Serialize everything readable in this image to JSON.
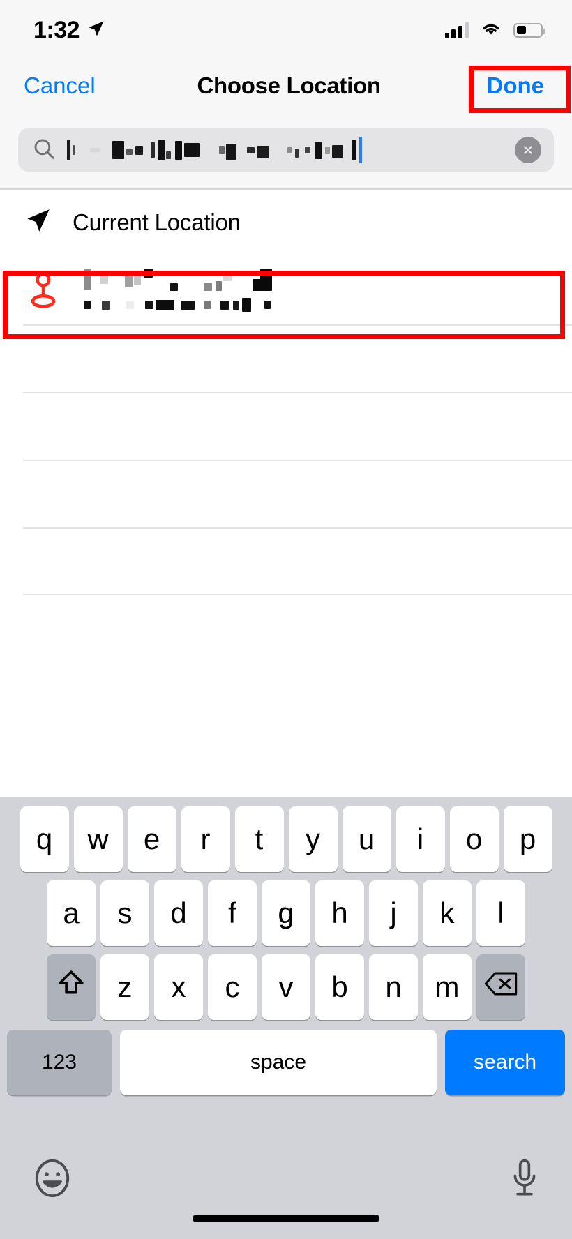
{
  "status_bar": {
    "time": "1:32",
    "location_arrow_icon": "location-arrow-icon",
    "signal_icon": "cellular-signal-icon",
    "signal_bars_filled": 3,
    "signal_bars_total": 4,
    "wifi_icon": "wifi-icon",
    "battery_icon": "battery-icon",
    "battery_level_percent": 40
  },
  "nav_bar": {
    "cancel_label": "Cancel",
    "title": "Choose Location",
    "done_label": "Done",
    "accent_color": "#007aff"
  },
  "search": {
    "icon": "search-icon",
    "value": "",
    "placeholder": "",
    "value_redacted": true,
    "clear_icon": "clear-circle-icon",
    "caret_color": "#2a7bf6"
  },
  "highlights": {
    "color": "#ff0000",
    "targets": [
      "done-button",
      "search-result-row"
    ]
  },
  "list": {
    "current_location": {
      "icon": "location-arrow-icon",
      "label": "Current Location"
    },
    "result": {
      "icon": "map-pin-icon",
      "icon_color": "#ff3b30",
      "title_redacted": true,
      "subtitle_redacted": true,
      "title": "",
      "subtitle": ""
    },
    "empty_rows": 4
  },
  "keyboard": {
    "rows": [
      [
        "q",
        "w",
        "e",
        "r",
        "t",
        "y",
        "u",
        "i",
        "o",
        "p"
      ],
      [
        "a",
        "s",
        "d",
        "f",
        "g",
        "h",
        "j",
        "k",
        "l"
      ],
      [
        "z",
        "x",
        "c",
        "v",
        "b",
        "n",
        "m"
      ]
    ],
    "shift_icon": "shift-arrow-icon",
    "backspace_icon": "backspace-icon",
    "numbers_label": "123",
    "space_label": "space",
    "return_label": "search",
    "return_color": "#007aff",
    "emoji_icon": "emoji-smiley-icon",
    "dictation_icon": "microphone-icon",
    "home_indicator": "home-indicator"
  }
}
